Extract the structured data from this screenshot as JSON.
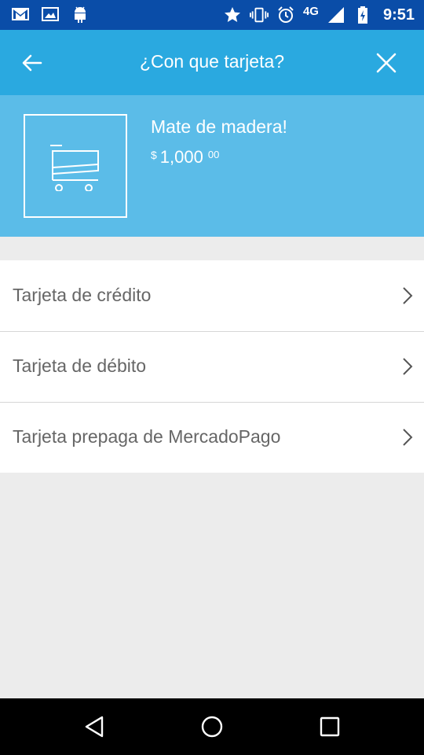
{
  "status_bar": {
    "left_icons": [
      "gmail-icon",
      "image-icon",
      "android-icon"
    ],
    "right_icons": [
      "star-icon",
      "vibrate-icon",
      "alarm-icon",
      "signal-icon",
      "battery-charging-icon"
    ],
    "network": "4G",
    "time": "9:51"
  },
  "header": {
    "back_icon": "arrow-left-icon",
    "title": "¿Con que tarjeta?",
    "close_icon": "close-icon",
    "background_color": "#2aa9e0"
  },
  "product": {
    "image_icon": "shopping-cart-icon",
    "name": "Mate de madera!",
    "price": {
      "currency": "$",
      "integer": "1,000",
      "decimals": "00"
    },
    "background_color": "#5bbce8"
  },
  "payment_options": [
    {
      "label": "Tarjeta de crédito",
      "icon": "chevron-right-icon"
    },
    {
      "label": "Tarjeta de débito",
      "icon": "chevron-right-icon"
    },
    {
      "label": "Tarjeta prepaga de MercadoPago",
      "icon": "chevron-right-icon"
    }
  ],
  "nav_bar": {
    "buttons": [
      "back-triangle-icon",
      "home-circle-icon",
      "recents-square-icon"
    ]
  }
}
